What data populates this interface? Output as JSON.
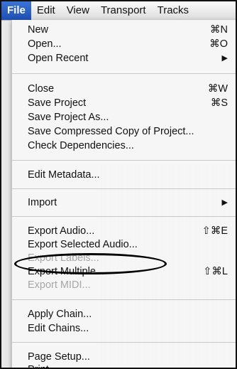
{
  "menubar": {
    "items": [
      {
        "label": "File"
      },
      {
        "label": "Edit"
      },
      {
        "label": "View"
      },
      {
        "label": "Transport"
      },
      {
        "label": "Tracks"
      }
    ]
  },
  "file_menu": {
    "new": {
      "label": "New",
      "shortcut": "⌘N"
    },
    "open": {
      "label": "Open...",
      "shortcut": "⌘O"
    },
    "open_recent": {
      "label": "Open Recent",
      "arrow": "▶"
    },
    "close": {
      "label": "Close",
      "shortcut": "⌘W"
    },
    "save_project": {
      "label": "Save Project",
      "shortcut": "⌘S"
    },
    "save_project_as": {
      "label": "Save Project As..."
    },
    "save_compressed": {
      "label": "Save Compressed Copy of Project..."
    },
    "check_dependencies": {
      "label": "Check Dependencies..."
    },
    "edit_metadata": {
      "label": "Edit Metadata..."
    },
    "import": {
      "label": "Import",
      "arrow": "▶"
    },
    "export_audio": {
      "label": "Export Audio...",
      "shortcut": "⇧⌘E"
    },
    "export_selected_audio": {
      "label": "Export Selected Audio..."
    },
    "export_labels": {
      "label": "Export Labels..."
    },
    "export_multiple": {
      "label": "Export Multiple...",
      "shortcut": "⇧⌘L"
    },
    "export_midi": {
      "label": "Export MIDI..."
    },
    "apply_chain": {
      "label": "Apply Chain..."
    },
    "edit_chains": {
      "label": "Edit Chains..."
    },
    "page_setup": {
      "label": "Page Setup..."
    },
    "print": {
      "label": "Print..."
    }
  }
}
